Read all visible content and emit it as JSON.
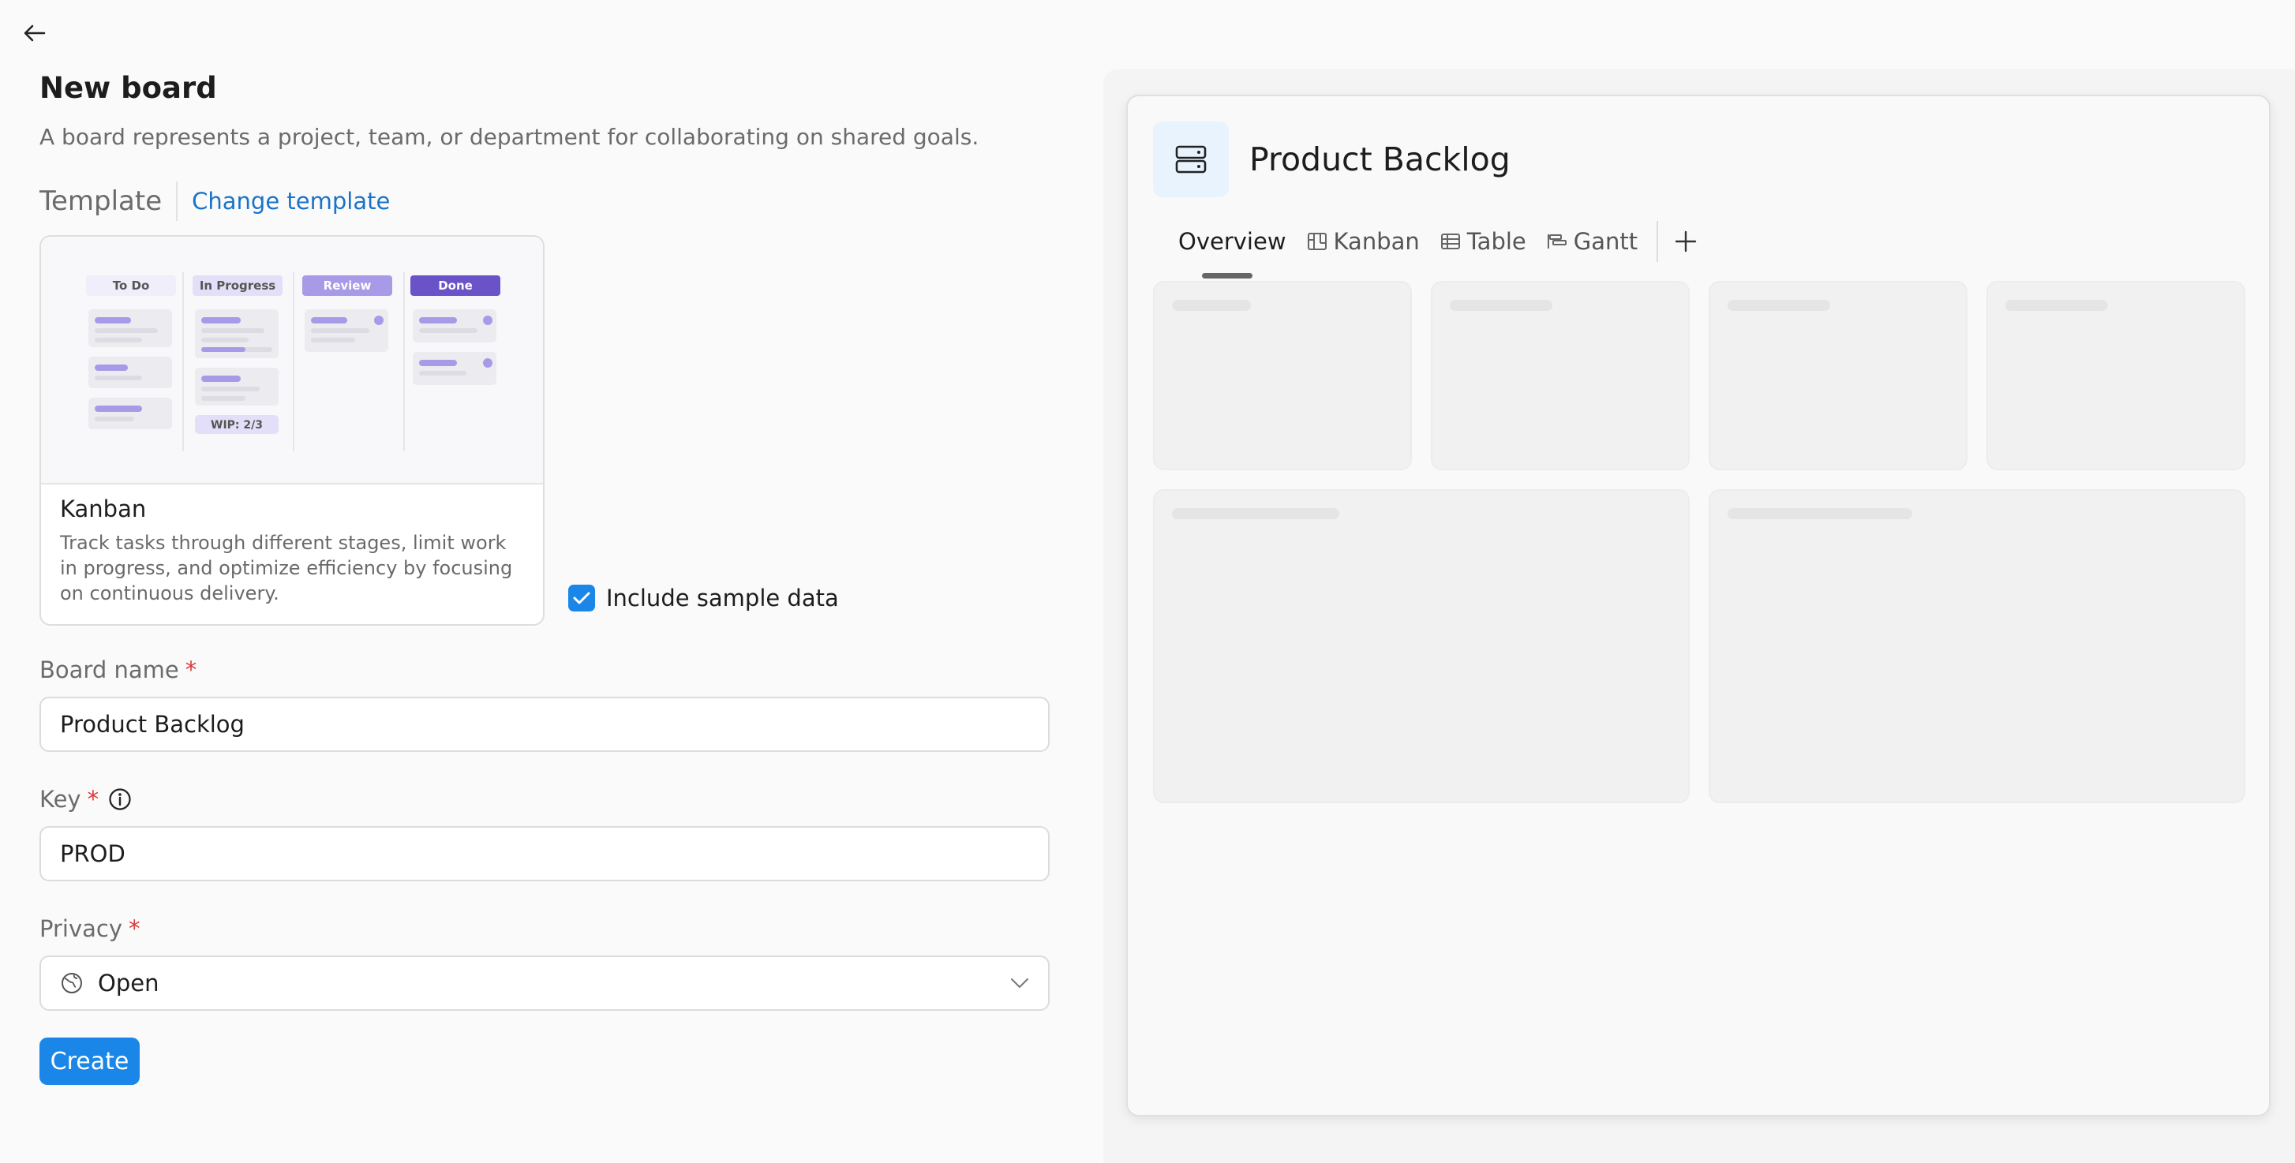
{
  "header": {
    "back_icon": "arrow-left-icon"
  },
  "form": {
    "title": "New board",
    "subtitle": "A board represents a project, team, or department for collaborating on shared goals.",
    "template_label": "Template",
    "change_template_label": "Change template",
    "template": {
      "name": "Kanban",
      "description": "Track tasks through different stages, limit work in progress, and optimize efficiency by focusing on continuous delivery.",
      "preview_columns": [
        "To Do",
        "In Progress",
        "Review",
        "Done"
      ],
      "wip_label": "WIP: 2/3"
    },
    "include_sample_label": "Include sample data",
    "include_sample_checked": true,
    "board_name_label": "Board name",
    "board_name_value": "Product Backlog",
    "key_label": "Key",
    "key_value": "PROD",
    "privacy_label": "Privacy",
    "privacy_value": "Open",
    "required_mark": "*",
    "create_label": "Create"
  },
  "preview": {
    "title": "Product Backlog",
    "icon": "server-icon",
    "tabs": [
      {
        "label": "Overview",
        "icon": "",
        "active": true
      },
      {
        "label": "Kanban",
        "icon": "kanban-icon",
        "active": false
      },
      {
        "label": "Table",
        "icon": "table-icon",
        "active": false
      },
      {
        "label": "Gantt",
        "icon": "gantt-icon",
        "active": false
      }
    ],
    "add_tab_icon": "plus-icon"
  },
  "colors": {
    "accent": "#1a87e8",
    "link": "#1a73c8",
    "required": "#d93a3a",
    "kanban_review": "#a99ae8",
    "kanban_done": "#6a52c9"
  }
}
